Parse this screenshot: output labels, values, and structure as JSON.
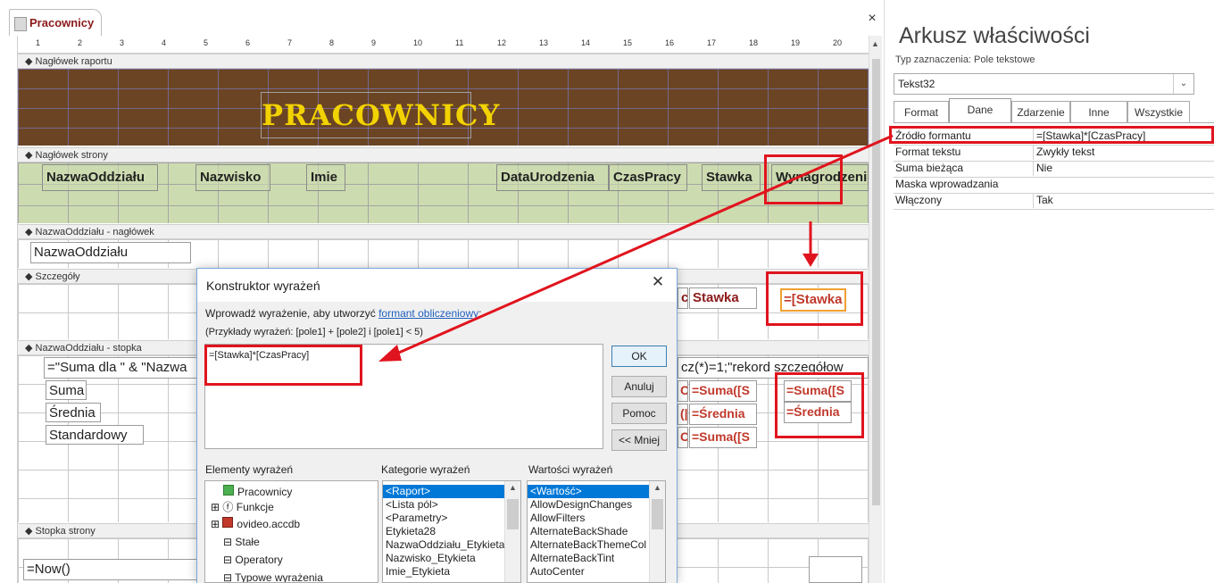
{
  "document_tab": {
    "label": "Pracownicy",
    "close": "×"
  },
  "ruler": {
    "ticks": [
      "1",
      "2",
      "3",
      "4",
      "5",
      "6",
      "7",
      "8",
      "9",
      "10",
      "11",
      "12",
      "13",
      "14",
      "15",
      "16",
      "17",
      "18",
      "19",
      "20"
    ]
  },
  "sections": {
    "report_header": "Nagłówek raportu",
    "page_header": "Nagłówek strony",
    "group_header": "NazwaOddziału - nagłówek",
    "details": "Szczegóły",
    "group_footer": "NazwaOddziału - stopka",
    "page_footer": "Stopka strony"
  },
  "report_title": "PRACOWNICY",
  "column_labels": [
    "NazwaOddziału",
    "Nazwisko",
    "Imie",
    "DataUrodzenia",
    "CzasPracy",
    "Stawka",
    "Wynagrodzenie"
  ],
  "group_header_field": "NazwaOddziału",
  "detail_fields": {
    "partial_label": "cy",
    "stawka": "Stawka",
    "calc": "=[Stawka"
  },
  "group_footer": {
    "expr_left": "=\"Suma dla \" & \"Nazwa",
    "expr_right": "cz(*)=1;\"rekord szczegółow",
    "labels": [
      "Suma",
      "Średnia",
      "Standardowy"
    ],
    "col_a": [
      "C:",
      "(|",
      "C:"
    ],
    "col_b": [
      "=Suma([S",
      "=Średnia",
      "=Suma([S"
    ],
    "col_c": [
      "=Suma([S",
      "=Średnia"
    ]
  },
  "page_footer_expr": "=Now()",
  "property_sheet": {
    "title": "Arkusz właściwości",
    "selection_type": "Typ zaznaczenia:  Pole tekstowe",
    "selected_control": "Tekst32",
    "tabs": [
      "Format",
      "Dane",
      "Zdarzenie",
      "Inne",
      "Wszystkie"
    ],
    "active_tab": "Dane",
    "rows": [
      {
        "key": "Źródło formantu",
        "value": "=[Stawka]*[CzasPracy]"
      },
      {
        "key": "Format tekstu",
        "value": "Zwykły tekst"
      },
      {
        "key": "Suma bieżąca",
        "value": "Nie"
      },
      {
        "key": "Maska wprowadzania",
        "value": ""
      },
      {
        "key": "Włączony",
        "value": "Tak"
      }
    ]
  },
  "dialog": {
    "title": "Konstruktor wyrażeń",
    "hint_prefix": "Wprowadź wyrażenie, aby utworzyć ",
    "hint_link": "formant obliczeniowy",
    "hint_suffix": ":",
    "examples": "(Przykłady wyrażeń: [pole1] + [pole2] i [pole1] < 5)",
    "expression": "=[Stawka]*[CzasPracy]",
    "buttons": {
      "ok": "OK",
      "cancel": "Anuluj",
      "help": "Pomoc",
      "less": "<< Mniej"
    },
    "elements_header": "Elementy wyrażeń",
    "categories_header": "Kategorie wyrażeń",
    "values_header": "Wartości wyrażeń",
    "elements": [
      "Pracownicy",
      "Funkcje",
      "ovideo.accdb",
      "Stałe",
      "Operatory",
      "Typowe wyrażenia"
    ],
    "categories": [
      "<Raport>",
      "<Lista pól>",
      "<Parametry>",
      "Etykieta28",
      "NazwaOddziału_Etykieta",
      "Nazwisko_Etykieta",
      "Imie_Etykieta"
    ],
    "values": [
      "<Wartość>",
      "AllowDesignChanges",
      "AllowFilters",
      "AlternateBackShade",
      "AlternateBackThemeCol",
      "AlternateBackTint",
      "AutoCenter"
    ]
  }
}
